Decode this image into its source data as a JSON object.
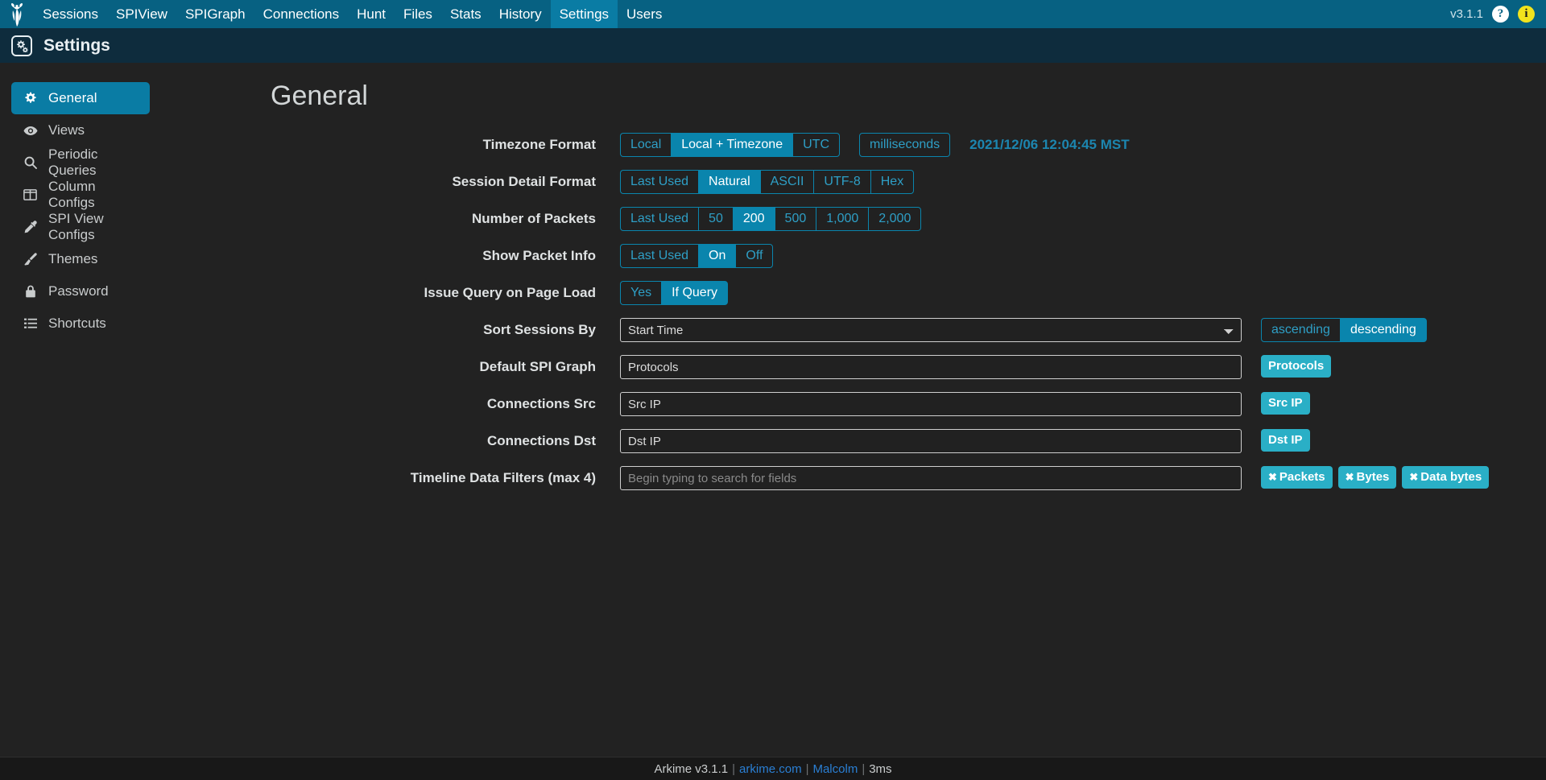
{
  "topnav": {
    "logo_icon": "arkime-owl-logo-icon",
    "items": [
      {
        "label": "Sessions",
        "active": false
      },
      {
        "label": "SPIView",
        "active": false
      },
      {
        "label": "SPIGraph",
        "active": false
      },
      {
        "label": "Connections",
        "active": false
      },
      {
        "label": "Hunt",
        "active": false
      },
      {
        "label": "Files",
        "active": false
      },
      {
        "label": "Stats",
        "active": false
      },
      {
        "label": "History",
        "active": false
      },
      {
        "label": "Settings",
        "active": true
      },
      {
        "label": "Users",
        "active": false
      }
    ],
    "version": "v3.1.1",
    "help_icon": "question-mark-help-icon",
    "help_glyph": "?",
    "info_icon": "info-circle-icon",
    "info_glyph": "i"
  },
  "subheader": {
    "icon": "gears-settings-icon",
    "title": "Settings"
  },
  "sidebar": {
    "items": [
      {
        "label": "General",
        "icon": "gear-icon",
        "active": true
      },
      {
        "label": "Views",
        "icon": "eye-icon",
        "active": false
      },
      {
        "label": "Periodic Queries",
        "icon": "search-icon",
        "active": false
      },
      {
        "label": "Column Configs",
        "icon": "columns-icon",
        "active": false
      },
      {
        "label": "SPI View Configs",
        "icon": "eyedropper-icon",
        "active": false
      },
      {
        "label": "Themes",
        "icon": "paintbrush-icon",
        "active": false
      },
      {
        "label": "Password",
        "icon": "lock-icon",
        "active": false
      },
      {
        "label": "Shortcuts",
        "icon": "list-icon",
        "active": false
      }
    ]
  },
  "main": {
    "title": "General",
    "rows": {
      "timezone": {
        "label": "Timezone Format",
        "options": [
          {
            "label": "Local",
            "active": false
          },
          {
            "label": "Local + Timezone",
            "active": true
          },
          {
            "label": "UTC",
            "active": false
          }
        ],
        "ms_option": {
          "label": "milliseconds",
          "active": false
        },
        "timestamp": "2021/12/06 12:04:45 MST"
      },
      "session_detail": {
        "label": "Session Detail Format",
        "options": [
          {
            "label": "Last Used",
            "active": false
          },
          {
            "label": "Natural",
            "active": true
          },
          {
            "label": "ASCII",
            "active": false
          },
          {
            "label": "UTF-8",
            "active": false
          },
          {
            "label": "Hex",
            "active": false
          }
        ]
      },
      "num_packets": {
        "label": "Number of Packets",
        "options": [
          {
            "label": "Last Used",
            "active": false
          },
          {
            "label": "50",
            "active": false
          },
          {
            "label": "200",
            "active": true
          },
          {
            "label": "500",
            "active": false
          },
          {
            "label": "1,000",
            "active": false
          },
          {
            "label": "2,000",
            "active": false
          }
        ]
      },
      "packet_info": {
        "label": "Show Packet Info",
        "options": [
          {
            "label": "Last Used",
            "active": false
          },
          {
            "label": "On",
            "active": true
          },
          {
            "label": "Off",
            "active": false
          }
        ]
      },
      "issue_query": {
        "label": "Issue Query on Page Load",
        "options": [
          {
            "label": "Yes",
            "active": false
          },
          {
            "label": "If Query",
            "active": true
          }
        ]
      },
      "sort_sessions": {
        "label": "Sort Sessions By",
        "value": "Start Time",
        "direction_options": [
          {
            "label": "ascending",
            "active": false
          },
          {
            "label": "descending",
            "active": true
          }
        ]
      },
      "default_spigraph": {
        "label": "Default SPI Graph",
        "value": "Protocols",
        "badges": [
          {
            "label": "Protocols",
            "removable": false
          }
        ]
      },
      "connections_src": {
        "label": "Connections Src",
        "value": "Src IP",
        "badges": [
          {
            "label": "Src IP",
            "removable": false
          }
        ]
      },
      "connections_dst": {
        "label": "Connections Dst",
        "value": "Dst IP",
        "badges": [
          {
            "label": "Dst IP",
            "removable": false
          }
        ]
      },
      "timeline_filters": {
        "label": "Timeline Data Filters (max 4)",
        "placeholder": "Begin typing to search for fields",
        "value": "",
        "badges": [
          {
            "label": "Packets",
            "removable": true
          },
          {
            "label": "Bytes",
            "removable": true
          },
          {
            "label": "Data bytes",
            "removable": true
          }
        ]
      }
    }
  },
  "footer": {
    "app": "Arkime v3.1.1",
    "sep1": "|",
    "link_site": "arkime.com",
    "sep2": "|",
    "link_malcolm": "Malcolm",
    "sep3": "|",
    "timing": "3ms"
  },
  "colors": {
    "nav_bg": "#076182",
    "nav_active": "#0a7ca4",
    "subheader_bg": "#0e2c3d",
    "body_bg": "#222222",
    "accent": "#0a85ad",
    "badge": "#2aafc6",
    "timestamp": "#1c86b0",
    "link": "#2a7fd4"
  }
}
